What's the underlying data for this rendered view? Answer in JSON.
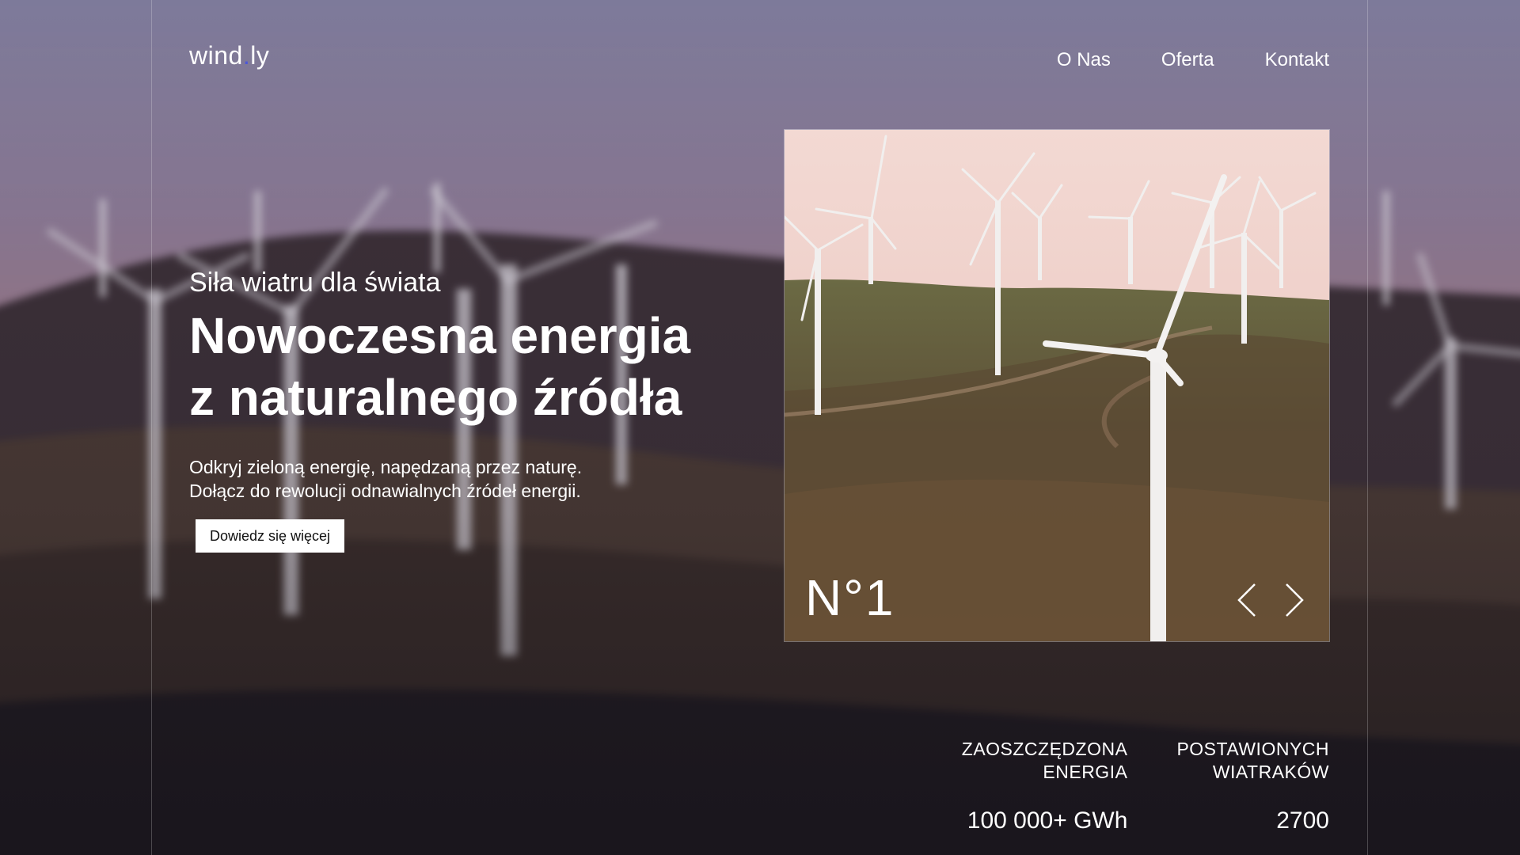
{
  "logo": {
    "text_a": "wind",
    "text_dot": ".",
    "text_b": "ly",
    "dot_color": "#4b57d8"
  },
  "nav": {
    "items": [
      "O Nas",
      "Oferta",
      "Kontakt"
    ]
  },
  "hero": {
    "subtitle": "Siła wiatru dla świata",
    "title_line1": "Nowoczesna energia",
    "title_line2": "z naturalnego źródła",
    "desc_line1": "Odkryj zieloną energię, napędzaną przez naturę.",
    "desc_line2": "Dołącz do rewolucji odnawialnych źródeł energii.",
    "cta": "Dowiedz się więcej"
  },
  "slider": {
    "number": "N°1",
    "prev_icon": "chevron-left-icon",
    "next_icon": "chevron-right-icon"
  },
  "stats": [
    {
      "label_line1": "ZAOSZCZĘDZONA",
      "label_line2": "ENERGIA",
      "value": "100 000+ GWh"
    },
    {
      "label_line1": "POSTAWIONYCH",
      "label_line2": "WIATRAKÓW",
      "value": "2700"
    }
  ]
}
